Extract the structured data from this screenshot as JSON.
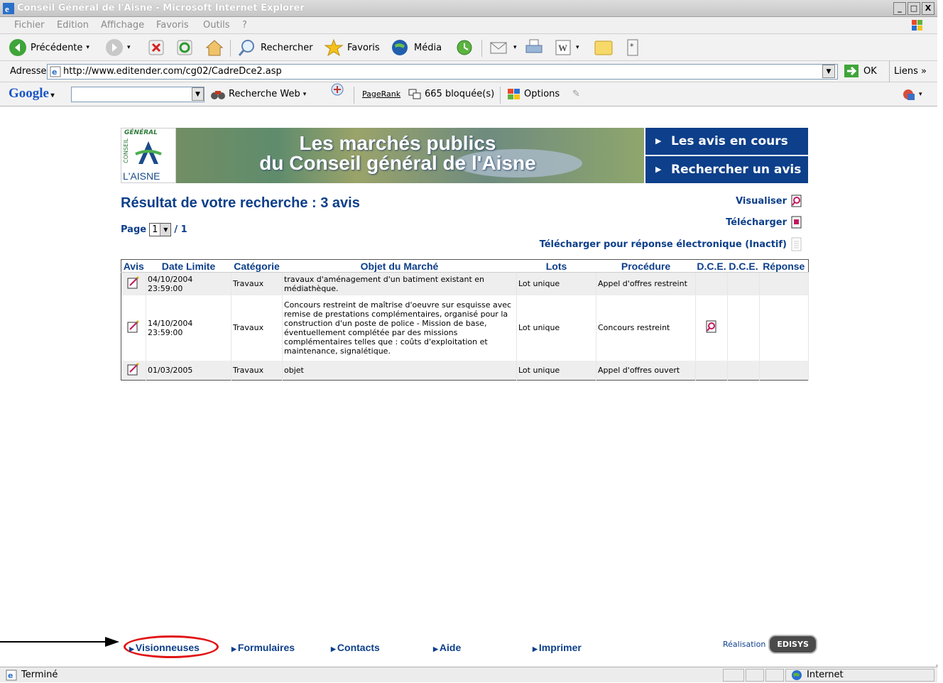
{
  "window": {
    "title": "Conseil Général de l'Aisne - Microsoft Internet Explorer",
    "controls": [
      "_",
      "□",
      "X"
    ]
  },
  "menu": {
    "items": [
      "Fichier",
      "Edition",
      "Affichage",
      "Favoris",
      "Outils",
      "?"
    ]
  },
  "toolbar": {
    "back": "Précédente",
    "search": "Rechercher",
    "favorites": "Favoris",
    "media": "Média"
  },
  "address": {
    "label": "Adresse",
    "url": "http://www.editender.com/cg02/CadreDce2.asp",
    "go": "OK",
    "links": "Liens"
  },
  "google": {
    "logo": "Google",
    "search_web": "Recherche Web",
    "pagerank": "PageRank",
    "blocked": "665 bloquée(s)",
    "options": "Options"
  },
  "banner": {
    "logo_top": "GÉNÉRAL",
    "logo_side": "CONSEIL",
    "logo_bottom": "L'AISNE",
    "title_line1": "Les marchés publics",
    "title_line2": "du Conseil général de l'Aisne",
    "nav": [
      "Les avis en cours",
      "Rechercher un avis"
    ]
  },
  "results": {
    "title": "Résultat de votre recherche : 3 avis",
    "page_label": "Page",
    "page_value": "1",
    "page_total": "/ 1",
    "actions": {
      "view": "Visualiser",
      "download": "Télécharger",
      "download_electronic": "Télécharger pour réponse électronique (Inactif)"
    },
    "columns": [
      "Avis",
      "Date Limite",
      "Catégorie",
      "Objet du Marché",
      "Lots",
      "Procédure",
      "D.C.E.",
      "D.C.E.",
      "Réponse"
    ],
    "rows": [
      {
        "date": "04/10/2004 23:59:00",
        "category": "Travaux",
        "object": "travaux d'aménagement d'un batiment existant en médiathèque.",
        "lots": "Lot unique",
        "procedure": "Appel d'offres restreint"
      },
      {
        "date": "14/10/2004 23:59:00",
        "category": "Travaux",
        "object": "Concours restreint de maîtrise d'oeuvre sur esquisse avec remise de prestations complémentaires, organisé pour la construction d'un poste de police - Mission de base, éventuellement complétée par des missions complémentaires telles que : coûts d'exploitation et maintenance, signalétique.",
        "lots": "Lot unique",
        "procedure": "Concours restreint"
      },
      {
        "date": "01/03/2005",
        "category": "Travaux",
        "object": "objet",
        "lots": "Lot unique",
        "procedure": "Appel d'offres ouvert"
      }
    ]
  },
  "footer": {
    "links": [
      "Visionneuses",
      "Formulaires",
      "Contacts",
      "Aide",
      "Imprimer"
    ],
    "realisation": "Réalisation",
    "brand": "EDISYS"
  },
  "status": {
    "text": "Terminé",
    "zone": "Internet"
  },
  "colors": {
    "brand_blue": "#0d3f8a",
    "annotation_red": "#e11414"
  }
}
